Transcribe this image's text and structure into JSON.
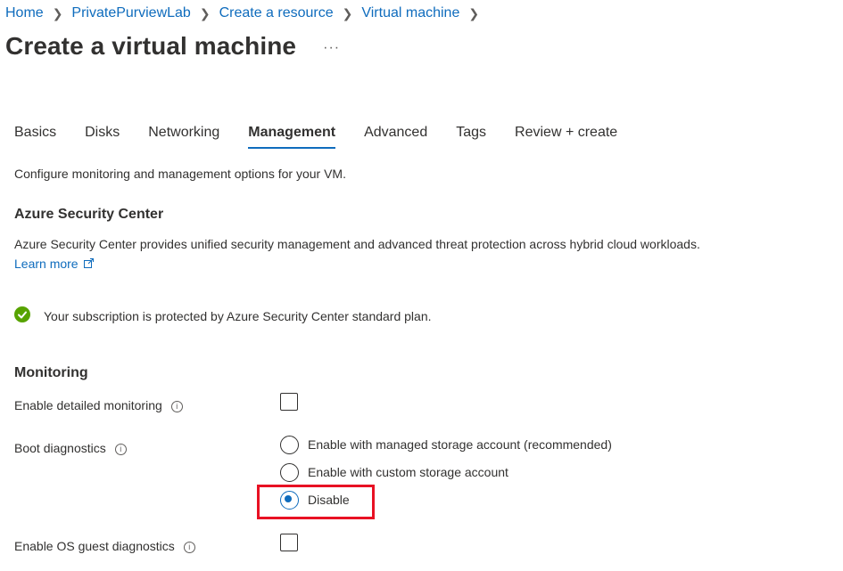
{
  "breadcrumb": [
    "Home",
    "PrivatePurviewLab",
    "Create a resource",
    "Virtual machine"
  ],
  "page_title": "Create a virtual machine",
  "more_label": "···",
  "tabs": [
    {
      "label": "Basics",
      "active": false
    },
    {
      "label": "Disks",
      "active": false
    },
    {
      "label": "Networking",
      "active": false
    },
    {
      "label": "Management",
      "active": true
    },
    {
      "label": "Advanced",
      "active": false
    },
    {
      "label": "Tags",
      "active": false
    },
    {
      "label": "Review + create",
      "active": false
    }
  ],
  "intro": "Configure monitoring and management options for your VM.",
  "security": {
    "heading": "Azure Security Center",
    "description": "Azure Security Center provides unified security management and advanced threat protection across hybrid cloud workloads.",
    "learn_more": "Learn more",
    "status": "Your subscription is protected by Azure Security Center standard plan."
  },
  "monitoring": {
    "heading": "Monitoring",
    "detailed_monitoring_label": "Enable detailed monitoring",
    "detailed_monitoring_checked": false,
    "boot_diagnostics_label": "Boot diagnostics",
    "boot_options": [
      {
        "label": "Enable with managed storage account (recommended)",
        "selected": false
      },
      {
        "label": "Enable with custom storage account",
        "selected": false
      },
      {
        "label": "Disable",
        "selected": true
      }
    ],
    "os_guest_label": "Enable OS guest diagnostics",
    "os_guest_checked": false
  },
  "colors": {
    "accent": "#0f6cbd",
    "success": "#57a300",
    "highlight": "#e81123"
  }
}
